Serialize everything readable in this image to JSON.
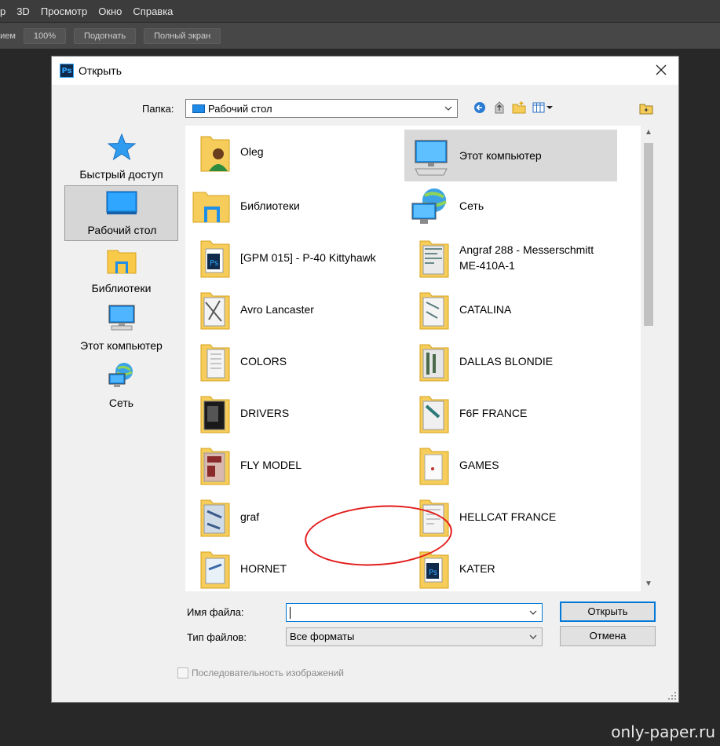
{
  "photoshop": {
    "menu": [
      "тр",
      "3D",
      "Просмотр",
      "Окно",
      "Справка"
    ],
    "options": {
      "label": "нием",
      "zoom": "100%",
      "fit": "Подогнать",
      "fullscreen": "Полный экран"
    }
  },
  "dialog": {
    "title": "Открыть",
    "folder_label": "Папка:",
    "folder_value": "Рабочий стол",
    "places": [
      "Быстрый доступ",
      "Рабочий стол",
      "Библиотеки",
      "Этот компьютер",
      "Сеть"
    ],
    "selected_place": "Рабочий стол",
    "files": [
      {
        "name": "Oleg",
        "icon": "user-folder-icon"
      },
      {
        "name": "Этот компьютер",
        "icon": "computer-icon",
        "selected": true
      },
      {
        "name": "Библиотеки",
        "icon": "libraries-icon"
      },
      {
        "name": "Сеть",
        "icon": "network-icon"
      },
      {
        "name": "[GPM 015] - P-40 Kittyhawk",
        "icon": "folder-icon"
      },
      {
        "name": "Angraf 288 - Messerschmitt ME-410A-1",
        "icon": "folder-icon"
      },
      {
        "name": "Avro Lancaster",
        "icon": "folder-icon"
      },
      {
        "name": "CATALINA",
        "icon": "folder-icon"
      },
      {
        "name": "COLORS",
        "icon": "folder-icon"
      },
      {
        "name": "DALLAS BLONDIE",
        "icon": "folder-icon"
      },
      {
        "name": "DRIVERS",
        "icon": "folder-icon"
      },
      {
        "name": "F6F FRANCE",
        "icon": "folder-icon"
      },
      {
        "name": "FLY MODEL",
        "icon": "folder-icon",
        "highlighted": true
      },
      {
        "name": "GAMES",
        "icon": "folder-icon"
      },
      {
        "name": "graf",
        "icon": "folder-icon"
      },
      {
        "name": "HELLCAT FRANCE",
        "icon": "folder-icon"
      },
      {
        "name": "HORNET",
        "icon": "folder-icon"
      },
      {
        "name": "KATER",
        "icon": "folder-icon"
      }
    ],
    "filename_label": "Имя файла:",
    "filename_value": "",
    "filetype_label": "Тип файлов:",
    "filetype_value": "Все форматы",
    "open_button": "Открыть",
    "cancel_button": "Отмена",
    "sequence_label": "Последовательность изображений"
  },
  "watermark": "only-paper.ru",
  "colors": {
    "accent": "#0078d7",
    "highlight_circle": "#e31c1c",
    "app_bg": "#282828"
  }
}
